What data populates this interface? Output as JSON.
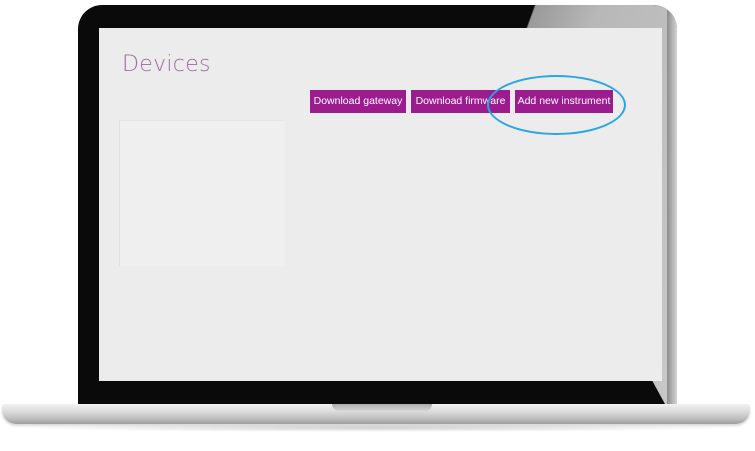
{
  "page": {
    "title": "Devices"
  },
  "toolbar": {
    "download_gateway_label": "Download gateway",
    "download_firmware_label": "Download firmware",
    "add_instrument_label": "Add new instrument"
  },
  "colors": {
    "brand_button": "#9c1c8f",
    "title_text": "#a06aa0",
    "screen_background": "#ececec",
    "highlight_ring": "#2aa6e8"
  }
}
